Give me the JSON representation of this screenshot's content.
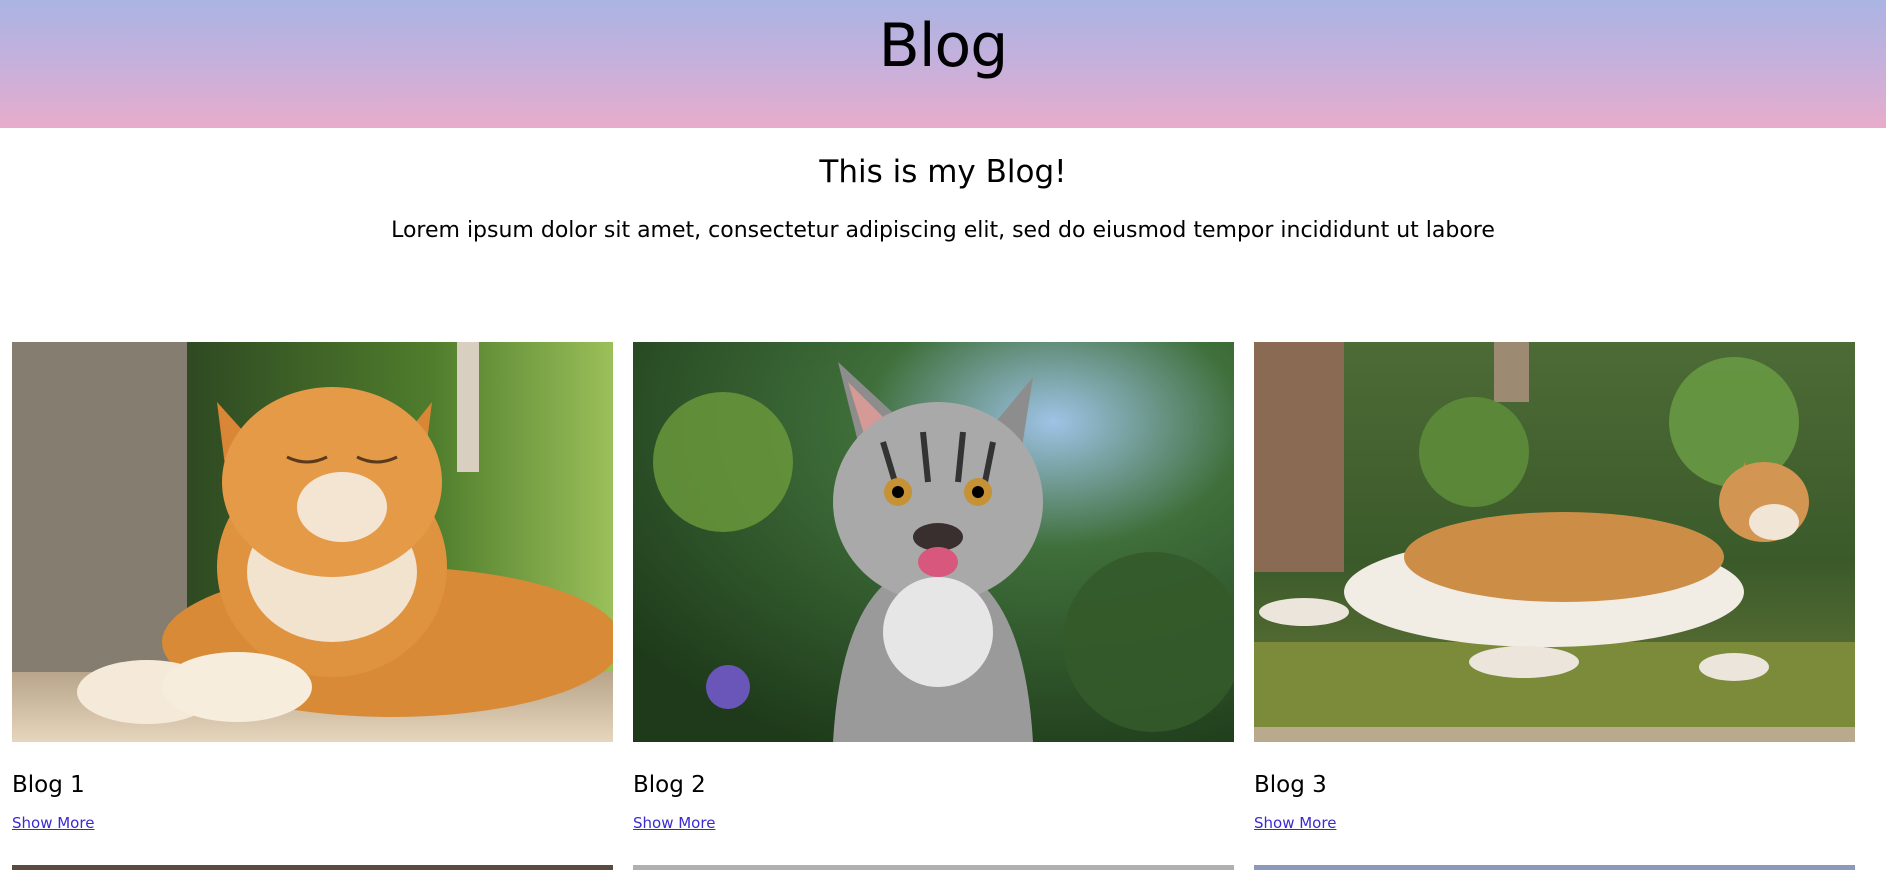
{
  "header": {
    "title": "Blog"
  },
  "intro": {
    "heading": "This is my Blog!",
    "text": "Lorem ipsum dolor sit amet, consectetur adipiscing elit, sed do eiusmod tempor incididunt ut labore"
  },
  "posts": [
    {
      "title": "Blog 1",
      "link": "Show More"
    },
    {
      "title": "Blog 2",
      "link": "Show More"
    },
    {
      "title": "Blog 3",
      "link": "Show More"
    }
  ],
  "colors": {
    "header_top": "#aab4e3",
    "header_bottom": "#e8accb",
    "link": "#3a2ad0"
  }
}
